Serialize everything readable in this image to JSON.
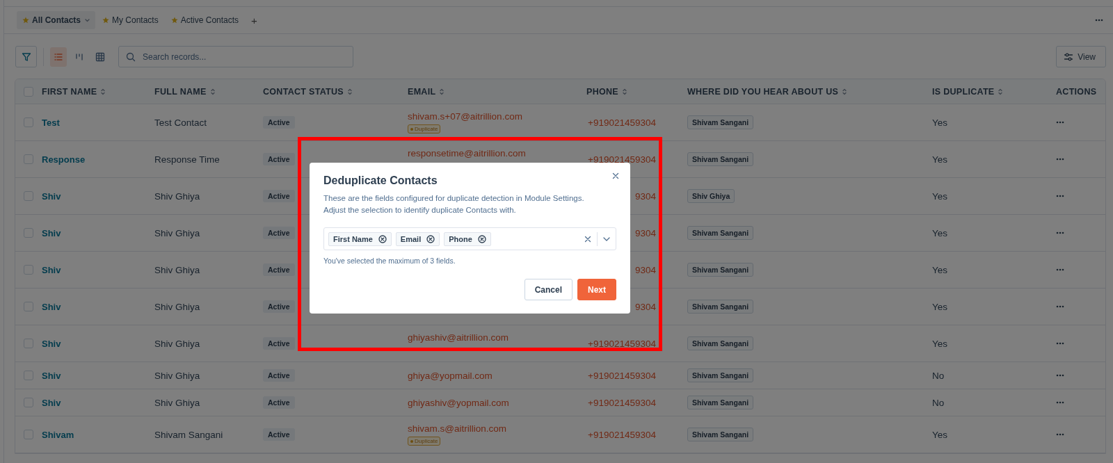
{
  "view_tabs": [
    {
      "label": "All Contacts",
      "selected": true,
      "dropdown": true
    },
    {
      "label": "My Contacts",
      "selected": false,
      "dropdown": false
    },
    {
      "label": "Active Contacts",
      "selected": false,
      "dropdown": false
    }
  ],
  "add_tab": "+",
  "toolbar": {
    "view_modes": [
      {
        "kind": "list",
        "selected": true
      },
      {
        "kind": "kanban",
        "selected": false
      },
      {
        "kind": "grid",
        "selected": false
      }
    ],
    "search": {
      "placeholder": "Search records..."
    },
    "view_button": "View"
  },
  "table": {
    "select_all_checked": false,
    "columns": [
      {
        "label": "FIRST NAME",
        "sortable": true
      },
      {
        "label": "FULL NAME",
        "sortable": true
      },
      {
        "label": "CONTACT STATUS",
        "sortable": true
      },
      {
        "label": "EMAIL",
        "sortable": true
      },
      {
        "label": "PHONE",
        "sortable": true
      },
      {
        "label": "WHERE DID YOU HEAR ABOUT US",
        "sortable": true
      },
      {
        "label": "IS DUPLICATE",
        "sortable": true
      },
      {
        "label": "ACTIONS",
        "sortable": false
      }
    ],
    "rows": [
      {
        "checked": false,
        "first_name": "Test",
        "full_name": "Test Contact",
        "status": "Active",
        "email": "shivam.s+07@aitrillion.com",
        "duplicate": true,
        "duplicate_label": "Duplicate",
        "phone": "+919021459304",
        "source": "Shivam Sangani",
        "is_duplicate": "Yes"
      },
      {
        "checked": false,
        "first_name": "Response",
        "full_name": "Response Time",
        "status": "Active",
        "email": "responsetime@aitrillion.com",
        "duplicate": true,
        "phone": "+919021459304",
        "source": "Shivam Sangani",
        "is_duplicate": "Yes"
      },
      {
        "checked": false,
        "first_name": "Shiv",
        "full_name": "Shiv Ghiya",
        "status": "Active",
        "duplicate": true,
        "phone": "9304",
        "source": "Shiv Ghiya",
        "is_duplicate": "Yes"
      },
      {
        "checked": false,
        "first_name": "Shiv",
        "full_name": "Shiv Ghiya",
        "status": "Active",
        "duplicate": true,
        "phone": "9304",
        "source": "Shivam Sangani",
        "is_duplicate": "Yes"
      },
      {
        "checked": false,
        "first_name": "Shiv",
        "full_name": "Shiv Ghiya",
        "status": "Active",
        "duplicate": true,
        "phone": "9304",
        "source": "Shivam Sangani",
        "is_duplicate": "Yes"
      },
      {
        "checked": false,
        "first_name": "Shiv",
        "full_name": "Shiv Ghiya",
        "status": "Active",
        "duplicate": true,
        "phone": "9304",
        "source": "Shivam Sangani",
        "is_duplicate": "Yes"
      },
      {
        "checked": false,
        "first_name": "Shiv",
        "full_name": "Shiv Ghiya",
        "status": "Active",
        "email": "ghiyashiv@aitrillion.com",
        "duplicate": true,
        "phone": "+919021459304",
        "source": "Shivam Sangani",
        "is_duplicate": "Yes"
      },
      {
        "checked": false,
        "first_name": "Shiv",
        "full_name": "Shiv Ghiya",
        "status": "Active",
        "email": "ghiya@yopmail.com",
        "duplicate": false,
        "phone": "+919021459304",
        "source": "Shivam Sangani",
        "is_duplicate": "No"
      },
      {
        "checked": false,
        "first_name": "Shiv",
        "full_name": "Shiv Ghiya",
        "status": "Active",
        "email": "ghiyashiv@yopmail.com",
        "duplicate": false,
        "phone": "+919021459304",
        "source": "Shivam Sangani",
        "is_duplicate": "No"
      },
      {
        "checked": false,
        "first_name": "Shivam",
        "full_name": "Shivam Sangani",
        "status": "Active",
        "email": "shivam.s@aitrillion.com",
        "duplicate": true,
        "duplicate_label": "Duplicate",
        "phone": "+919021459304",
        "source": "Shivam Sangani",
        "is_duplicate": "Yes"
      }
    ]
  },
  "modal": {
    "title": "Deduplicate Contacts",
    "description": "These are the fields configured for duplicate detection in Module Settings. Adjust the selection to identify duplicate Contacts with.",
    "selected_fields": [
      "First Name",
      "Email",
      "Phone"
    ],
    "hint": "You've selected the maximum of 3 fields.",
    "buttons": [
      {
        "label": "Cancel",
        "kind": "secondary"
      },
      {
        "label": "Next",
        "kind": "primary"
      }
    ]
  }
}
